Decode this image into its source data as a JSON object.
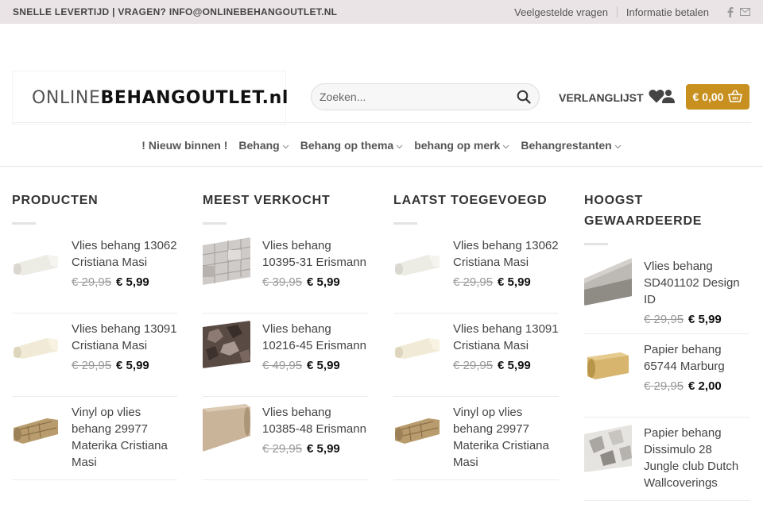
{
  "topbar": {
    "left_text": "SNELLE LEVERTIJD | VRAGEN? INFO@ONLINEBEHANGOUTLET.NL",
    "links": [
      "Veelgestelde vragen",
      "Informatie betalen"
    ],
    "social_icons": [
      "facebook-icon",
      "email-icon"
    ]
  },
  "header": {
    "logo_part1": "ONLINE",
    "logo_part2": "BEHANGOUTLET.nl",
    "search_placeholder": "Zoeken...",
    "wishlist_label": "VERLANGLIJST",
    "cart_label": "€ 0,00"
  },
  "nav": {
    "items": [
      {
        "label": "! Nieuw binnen !",
        "dropdown": false
      },
      {
        "label": "Behang",
        "dropdown": true
      },
      {
        "label": "Behang op thema",
        "dropdown": true
      },
      {
        "label": "behang op merk",
        "dropdown": true
      },
      {
        "label": "Behangrestanten",
        "dropdown": true
      }
    ]
  },
  "colors": {
    "topbar_bg": "#ebe4e6",
    "cart_bg": "#c7901f",
    "text_dark": "#333333"
  },
  "columns": [
    {
      "title": "PRODUCTEN",
      "products": [
        {
          "name": "Vlies behang 13062 Cristiana Masi",
          "old_price": "€ 29,95",
          "price": "€ 5,99",
          "thumb": "white-roll"
        },
        {
          "name": "Vlies behang 13091 Cristiana Masi",
          "old_price": "€ 29,95",
          "price": "€ 5,99",
          "thumb": "cream-roll"
        },
        {
          "name": "Vinyl op vlies behang 29977 Materika Cristiana Masi",
          "old_price": "",
          "price": "",
          "thumb": "brick-roll"
        }
      ]
    },
    {
      "title": "MEEST VERKOCHT",
      "products": [
        {
          "name": "Vlies behang 10395-31 Erismann",
          "old_price": "€ 39,95",
          "price": "€ 5,99",
          "thumb": "stone-grey"
        },
        {
          "name": "Vlies behang 10216-45 Erismann",
          "old_price": "€ 49,95",
          "price": "€ 5,99",
          "thumb": "hexagon-dark"
        },
        {
          "name": "Vlies behang 10385-48 Erismann",
          "old_price": "€ 29,95",
          "price": "€ 5,99",
          "thumb": "beige-roll"
        }
      ]
    },
    {
      "title": "LAATST TOEGEVOEGD",
      "products": [
        {
          "name": "Vlies behang 13062 Cristiana Masi",
          "old_price": "€ 29,95",
          "price": "€ 5,99",
          "thumb": "white-roll"
        },
        {
          "name": "Vlies behang 13091 Cristiana Masi",
          "old_price": "€ 29,95",
          "price": "€ 5,99",
          "thumb": "cream-roll"
        },
        {
          "name": "Vinyl op vlies behang 29977 Materika Cristiana Masi",
          "old_price": "",
          "price": "",
          "thumb": "brick-roll"
        }
      ]
    },
    {
      "title": "HOOGST GEWAARDEERDE",
      "products": [
        {
          "name": "Vlies behang SD401102 Design ID",
          "old_price": "€ 29,95",
          "price": "€ 5,99",
          "thumb": "grey-roll"
        },
        {
          "name": "Papier behang 65744 Marburg",
          "old_price": "€ 29,95",
          "price": "€ 2,00",
          "thumb": "gold-roll"
        },
        {
          "name": "Papier behang Dissimulo 28 Jungle club Dutch Wallcoverings",
          "old_price": "",
          "price": "",
          "thumb": "jungle-grey"
        }
      ]
    }
  ]
}
